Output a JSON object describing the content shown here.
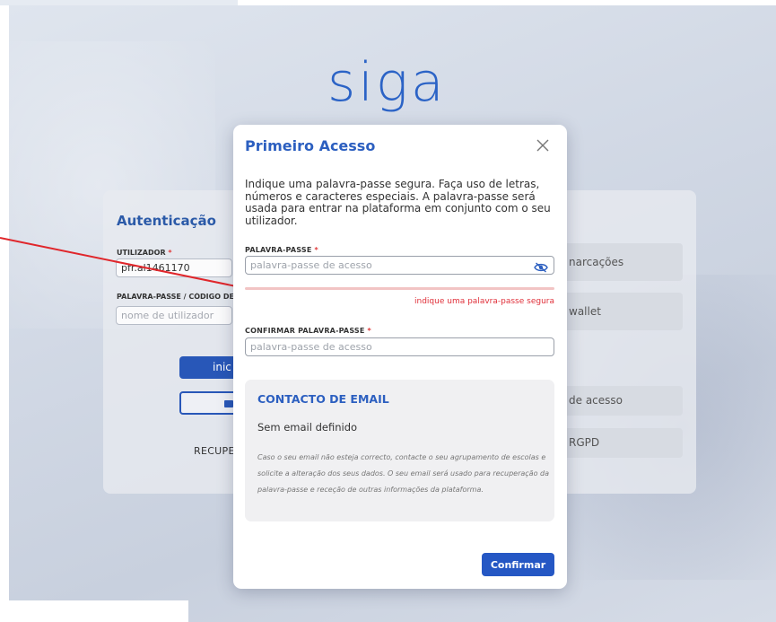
{
  "background": {
    "logo": "siga",
    "auth_title": "Autenticação",
    "username_label": "UTILIZADOR",
    "username_value": "pfr.al1461170",
    "password_label": "PALAVRA-PASSE / CÓDIGO DE A",
    "password_placeholder": "nome de utilizador",
    "primary_button_partial": "inic",
    "recover_link_partial": "RECUPE",
    "right_buttons": [
      {
        "label": "narcações"
      },
      {
        "label": "wallet"
      },
      {
        "label": "de acesso"
      },
      {
        "label": "RGPD"
      }
    ],
    "required_mark": "*"
  },
  "modal": {
    "title": "Primeiro Acesso",
    "description": "Indique uma palavra-passe segura. Faça uso de letras, números e caracteres especiais. A palavra-passe será usada para entrar na plataforma em conjunto com o seu utilizador.",
    "password": {
      "label": "PALAVRA-PASSE",
      "placeholder": "palavra-passe de acesso",
      "value": "",
      "error": "indique uma palavra-passe segura"
    },
    "confirm_password": {
      "label": "CONFIRMAR PALAVRA-PASSE",
      "placeholder": "palavra-passe de acesso",
      "value": ""
    },
    "email": {
      "title": "CONTACTO DE EMAIL",
      "value": "Sem email definido",
      "note": "Caso o seu email não esteja correcto, contacte o seu agrupamento de escolas e solicite a alteração dos seus dados. O seu email será usado para recuperação da palavra-passe e receção de outras informações da plataforma."
    },
    "confirm_button": "Confirmar",
    "required_mark": "*"
  },
  "colors": {
    "accent": "#2c5fc0",
    "error": "#e0303a",
    "annotation_arrow": "#e0262b"
  },
  "icons": {
    "close": "close-icon",
    "password_visibility": "eye-slash-icon"
  }
}
